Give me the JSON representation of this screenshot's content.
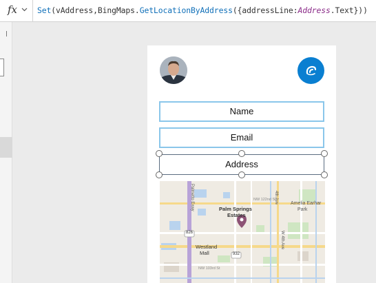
{
  "formula_bar": {
    "fx_label": "fx",
    "tokens": [
      "Set",
      "(vAddress,BingMaps.",
      "GetLocationByAddress",
      "({addressLine:",
      "Address",
      ".Text}))"
    ]
  },
  "form": {
    "name_placeholder": "Name",
    "email_placeholder": "Email",
    "address_placeholder": "Address"
  },
  "map": {
    "labels": {
      "palm_springs": "Palm Springs",
      "estates": "Estates",
      "westland": "Westland",
      "mall": "Mall",
      "amelia": "Amelia Earhar",
      "park": "Park",
      "road_826": "826",
      "road_932": "932",
      "ave_4th": "4th Ave",
      "ave_w4th": "W 4th Ave",
      "street_122": "NW 122nd St",
      "street_103": "NW 103rd St",
      "palmetto": "Palmetto Exwy"
    }
  },
  "colors": {
    "accent": "#0a7fd1",
    "field_border": "#8ac6ea",
    "pin": "#8d5275"
  }
}
